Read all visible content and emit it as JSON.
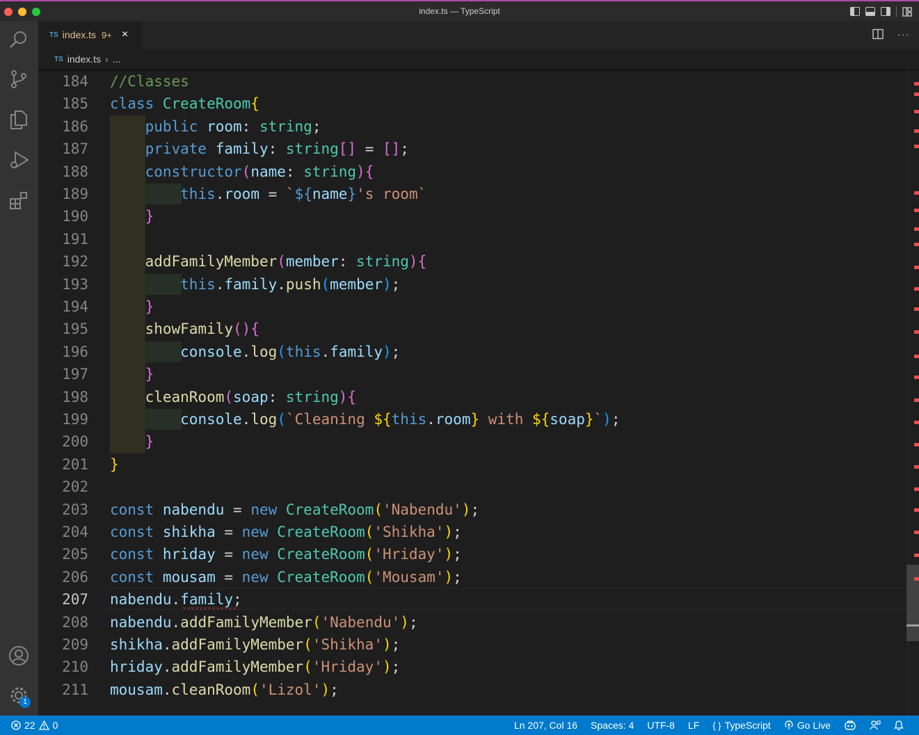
{
  "window": {
    "title": "index.ts — TypeScript"
  },
  "tab": {
    "lang_badge": "TS",
    "name": "index.ts",
    "problems": "9+",
    "close": "×"
  },
  "breadcrumb": {
    "lang_badge": "TS",
    "file": "index.ts",
    "separator": "›",
    "more": "..."
  },
  "tab_actions": {
    "more": "···"
  },
  "editor": {
    "lines": [
      {
        "n": "184",
        "tokens": [
          [
            "t-com",
            "//Classes"
          ]
        ]
      },
      {
        "n": "185",
        "tokens": [
          [
            "t-kw",
            "class "
          ],
          [
            "t-cls",
            "CreateRoom"
          ],
          [
            "t-br1",
            "{"
          ]
        ]
      },
      {
        "n": "186",
        "tokens": [
          [
            "t-op",
            "    "
          ],
          [
            "t-kw",
            "public "
          ],
          [
            "t-var",
            "room"
          ],
          [
            "t-op",
            ": "
          ],
          [
            "t-cls",
            "string"
          ],
          [
            "t-op",
            ";"
          ]
        ]
      },
      {
        "n": "187",
        "tokens": [
          [
            "t-op",
            "    "
          ],
          [
            "t-kw",
            "private "
          ],
          [
            "t-var",
            "family"
          ],
          [
            "t-op",
            ": "
          ],
          [
            "t-cls",
            "string"
          ],
          [
            "t-br2",
            "[]"
          ],
          [
            "t-op",
            " = "
          ],
          [
            "t-br2",
            "[]"
          ],
          [
            "t-op",
            ";"
          ]
        ]
      },
      {
        "n": "188",
        "tokens": [
          [
            "t-op",
            "    "
          ],
          [
            "t-kw",
            "constructor"
          ],
          [
            "t-br2",
            "("
          ],
          [
            "t-var",
            "name"
          ],
          [
            "t-op",
            ": "
          ],
          [
            "t-cls",
            "string"
          ],
          [
            "t-br2",
            ")"
          ],
          [
            "t-br2",
            "{"
          ]
        ]
      },
      {
        "n": "189",
        "tokens": [
          [
            "t-op",
            "        "
          ],
          [
            "t-kw",
            "this"
          ],
          [
            "t-op",
            "."
          ],
          [
            "t-var",
            "room"
          ],
          [
            "t-op",
            " = "
          ],
          [
            "t-str",
            "`"
          ],
          [
            "t-kw",
            "${"
          ],
          [
            "t-var",
            "name"
          ],
          [
            "t-kw",
            "}"
          ],
          [
            "t-str",
            "'s room`"
          ]
        ]
      },
      {
        "n": "190",
        "tokens": [
          [
            "t-op",
            "    "
          ],
          [
            "t-br2",
            "}"
          ]
        ]
      },
      {
        "n": "191",
        "tokens": []
      },
      {
        "n": "192",
        "tokens": [
          [
            "t-op",
            "    "
          ],
          [
            "t-fn",
            "addFamilyMember"
          ],
          [
            "t-br2",
            "("
          ],
          [
            "t-var",
            "member"
          ],
          [
            "t-op",
            ": "
          ],
          [
            "t-cls",
            "string"
          ],
          [
            "t-br2",
            ")"
          ],
          [
            "t-br2",
            "{"
          ]
        ]
      },
      {
        "n": "193",
        "tokens": [
          [
            "t-op",
            "        "
          ],
          [
            "t-kw",
            "this"
          ],
          [
            "t-op",
            "."
          ],
          [
            "t-var",
            "family"
          ],
          [
            "t-op",
            "."
          ],
          [
            "t-fn",
            "push"
          ],
          [
            "t-br3",
            "("
          ],
          [
            "t-var",
            "member"
          ],
          [
            "t-br3",
            ")"
          ],
          [
            "t-op",
            ";"
          ]
        ]
      },
      {
        "n": "194",
        "tokens": [
          [
            "t-op",
            "    "
          ],
          [
            "t-br2",
            "}"
          ]
        ]
      },
      {
        "n": "195",
        "tokens": [
          [
            "t-op",
            "    "
          ],
          [
            "t-fn",
            "showFamily"
          ],
          [
            "t-br2",
            "()"
          ],
          [
            "t-br2",
            "{"
          ]
        ]
      },
      {
        "n": "196",
        "tokens": [
          [
            "t-op",
            "        "
          ],
          [
            "t-var",
            "console"
          ],
          [
            "t-op",
            "."
          ],
          [
            "t-fn",
            "log"
          ],
          [
            "t-br3",
            "("
          ],
          [
            "t-kw",
            "this"
          ],
          [
            "t-op",
            "."
          ],
          [
            "t-var",
            "family"
          ],
          [
            "t-br3",
            ")"
          ],
          [
            "t-op",
            ";"
          ]
        ]
      },
      {
        "n": "197",
        "tokens": [
          [
            "t-op",
            "    "
          ],
          [
            "t-br2",
            "}"
          ]
        ]
      },
      {
        "n": "198",
        "tokens": [
          [
            "t-op",
            "    "
          ],
          [
            "t-fn",
            "cleanRoom"
          ],
          [
            "t-br2",
            "("
          ],
          [
            "t-var",
            "soap"
          ],
          [
            "t-op",
            ": "
          ],
          [
            "t-cls",
            "string"
          ],
          [
            "t-br2",
            ")"
          ],
          [
            "t-br2",
            "{"
          ]
        ]
      },
      {
        "n": "199",
        "tokens": [
          [
            "t-op",
            "        "
          ],
          [
            "t-var",
            "console"
          ],
          [
            "t-op",
            "."
          ],
          [
            "t-fn",
            "log"
          ],
          [
            "t-br3",
            "("
          ],
          [
            "t-str",
            "`Cleaning "
          ],
          [
            "t-br1",
            "${"
          ],
          [
            "t-kw",
            "this"
          ],
          [
            "t-op",
            "."
          ],
          [
            "t-var",
            "room"
          ],
          [
            "t-br1",
            "}"
          ],
          [
            "t-str",
            " with "
          ],
          [
            "t-br1",
            "${"
          ],
          [
            "t-var",
            "soap"
          ],
          [
            "t-br1",
            "}"
          ],
          [
            "t-str",
            "`"
          ],
          [
            "t-br3",
            ")"
          ],
          [
            "t-op",
            ";"
          ]
        ]
      },
      {
        "n": "200",
        "tokens": [
          [
            "t-op",
            "    "
          ],
          [
            "t-br2",
            "}"
          ]
        ]
      },
      {
        "n": "201",
        "tokens": [
          [
            "t-br1",
            "}"
          ]
        ]
      },
      {
        "n": "202",
        "tokens": []
      },
      {
        "n": "203",
        "tokens": [
          [
            "t-kw",
            "const "
          ],
          [
            "t-var",
            "nabendu"
          ],
          [
            "t-op",
            " = "
          ],
          [
            "t-kw",
            "new "
          ],
          [
            "t-cls",
            "CreateRoom"
          ],
          [
            "t-br1",
            "("
          ],
          [
            "t-str",
            "'Nabendu'"
          ],
          [
            "t-br1",
            ")"
          ],
          [
            "t-op",
            ";"
          ]
        ]
      },
      {
        "n": "204",
        "tokens": [
          [
            "t-kw",
            "const "
          ],
          [
            "t-var",
            "shikha"
          ],
          [
            "t-op",
            " = "
          ],
          [
            "t-kw",
            "new "
          ],
          [
            "t-cls",
            "CreateRoom"
          ],
          [
            "t-br1",
            "("
          ],
          [
            "t-str",
            "'Shikha'"
          ],
          [
            "t-br1",
            ")"
          ],
          [
            "t-op",
            ";"
          ]
        ]
      },
      {
        "n": "205",
        "tokens": [
          [
            "t-kw",
            "const "
          ],
          [
            "t-var",
            "hriday"
          ],
          [
            "t-op",
            " = "
          ],
          [
            "t-kw",
            "new "
          ],
          [
            "t-cls",
            "CreateRoom"
          ],
          [
            "t-br1",
            "("
          ],
          [
            "t-str",
            "'Hriday'"
          ],
          [
            "t-br1",
            ")"
          ],
          [
            "t-op",
            ";"
          ]
        ]
      },
      {
        "n": "206",
        "tokens": [
          [
            "t-kw",
            "const "
          ],
          [
            "t-var",
            "mousam"
          ],
          [
            "t-op",
            " = "
          ],
          [
            "t-kw",
            "new "
          ],
          [
            "t-cls",
            "CreateRoom"
          ],
          [
            "t-br1",
            "("
          ],
          [
            "t-str",
            "'Mousam'"
          ],
          [
            "t-br1",
            ")"
          ],
          [
            "t-op",
            ";"
          ]
        ]
      },
      {
        "n": "207",
        "tokens": [
          [
            "t-var",
            "nabendu"
          ],
          [
            "t-op",
            "."
          ],
          [
            "t-var",
            "family"
          ],
          [
            "t-op",
            ";"
          ]
        ]
      },
      {
        "n": "208",
        "tokens": [
          [
            "t-var",
            "nabendu"
          ],
          [
            "t-op",
            "."
          ],
          [
            "t-fn",
            "addFamilyMember"
          ],
          [
            "t-br1",
            "("
          ],
          [
            "t-str",
            "'Nabendu'"
          ],
          [
            "t-br1",
            ")"
          ],
          [
            "t-op",
            ";"
          ]
        ]
      },
      {
        "n": "209",
        "tokens": [
          [
            "t-var",
            "shikha"
          ],
          [
            "t-op",
            "."
          ],
          [
            "t-fn",
            "addFamilyMember"
          ],
          [
            "t-br1",
            "("
          ],
          [
            "t-str",
            "'Shikha'"
          ],
          [
            "t-br1",
            ")"
          ],
          [
            "t-op",
            ";"
          ]
        ]
      },
      {
        "n": "210",
        "tokens": [
          [
            "t-var",
            "hriday"
          ],
          [
            "t-op",
            "."
          ],
          [
            "t-fn",
            "addFamilyMember"
          ],
          [
            "t-br1",
            "("
          ],
          [
            "t-str",
            "'Hriday'"
          ],
          [
            "t-br1",
            ")"
          ],
          [
            "t-op",
            ";"
          ]
        ]
      },
      {
        "n": "211",
        "tokens": [
          [
            "t-var",
            "mousam"
          ],
          [
            "t-op",
            "."
          ],
          [
            "t-fn",
            "cleanRoom"
          ],
          [
            "t-br1",
            "("
          ],
          [
            "t-str",
            "'Lizol'"
          ],
          [
            "t-br1",
            ")"
          ],
          [
            "t-op",
            ";"
          ]
        ]
      }
    ],
    "active_line": "207"
  },
  "activity": {
    "settings_badge": "1"
  },
  "statusbar": {
    "errors": "22",
    "warnings": "0",
    "position": "Ln 207, Col 16",
    "spaces": "Spaces: 4",
    "encoding": "UTF-8",
    "eol": "LF",
    "language": "TypeScript",
    "golive": "Go Live"
  },
  "colors": {
    "statusbar": "#007acc",
    "accent": "#0078d4",
    "error": "#f14c4c"
  }
}
